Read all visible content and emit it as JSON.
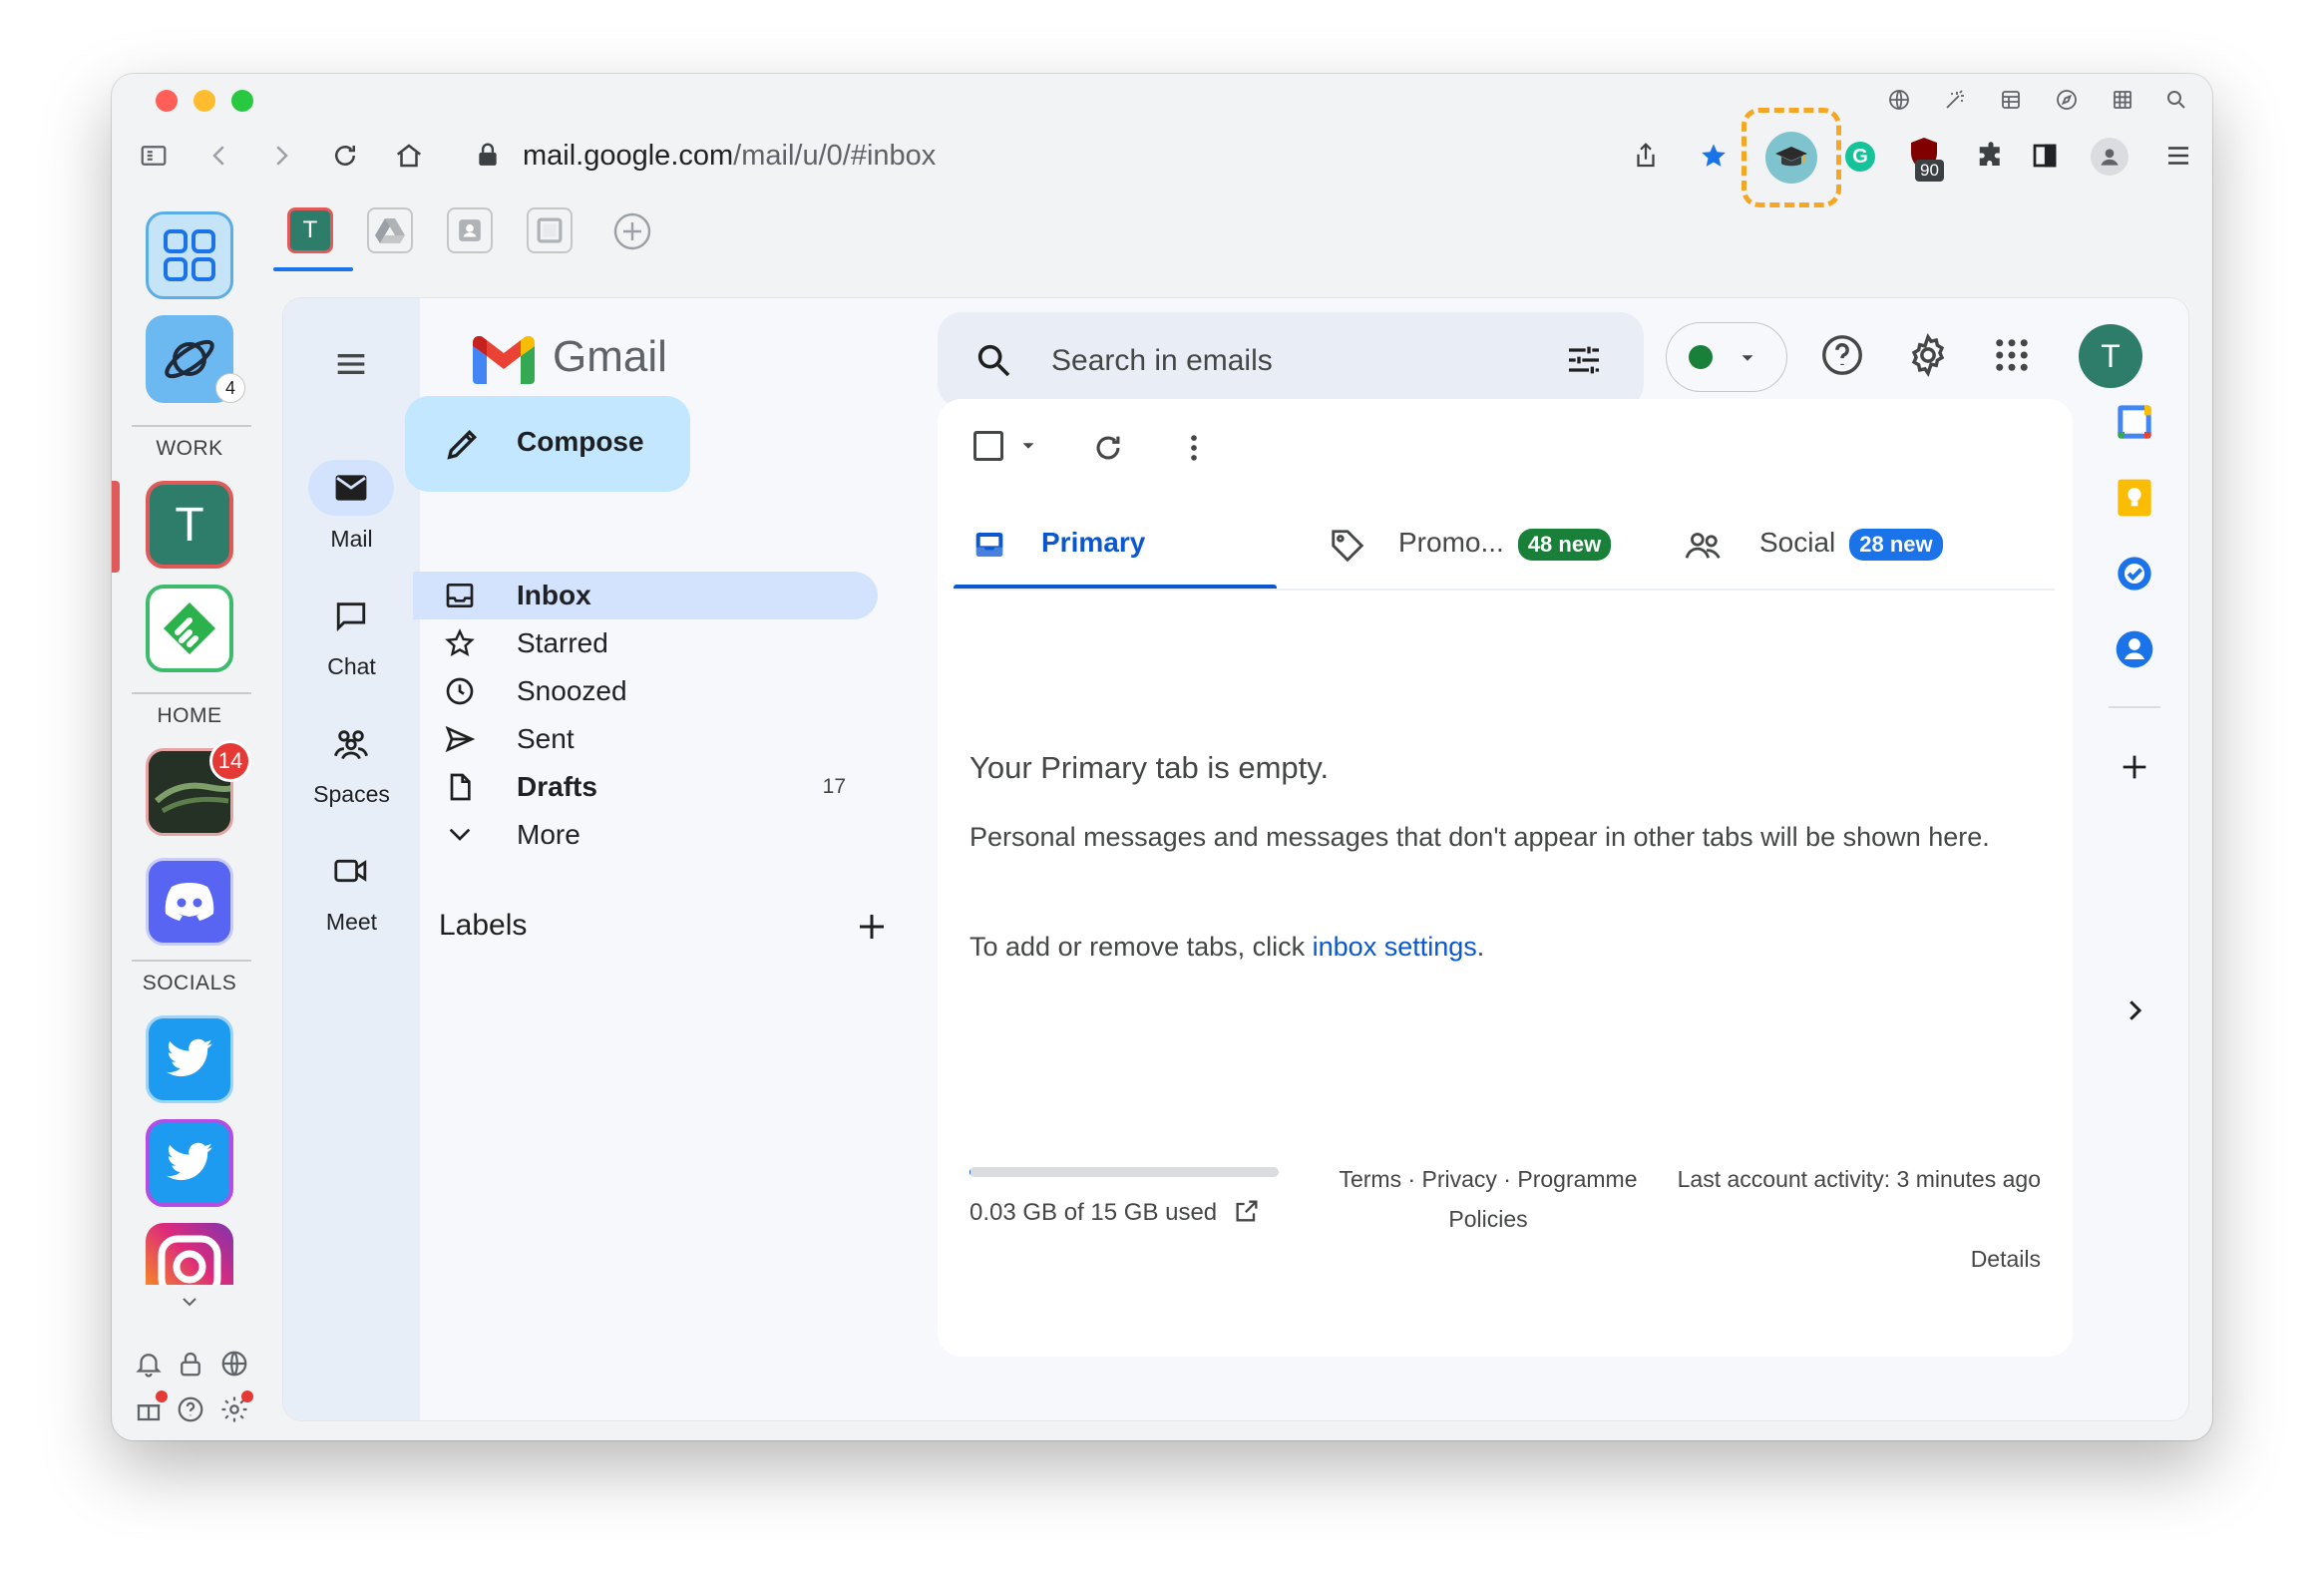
{
  "browser": {
    "url_host": "mail.google.com",
    "url_path": "/mail/u/0/#inbox",
    "pinned_tabs": [
      "T"
    ],
    "extension_badge": "90"
  },
  "sidebar": {
    "top_badge": "4",
    "sections": {
      "work": "WORK",
      "home": "HOME",
      "socials": "SOCIALS"
    },
    "work_app_letter": "T",
    "home_badge": "14"
  },
  "gmail": {
    "brand": "Gmail",
    "compose_label": "Compose",
    "search_placeholder": "Search in emails",
    "avatar_letter": "T",
    "rail": {
      "mail": "Mail",
      "chat": "Chat",
      "spaces": "Spaces",
      "meet": "Meet"
    },
    "nav": {
      "inbox": "Inbox",
      "starred": "Starred",
      "snoozed": "Snoozed",
      "sent": "Sent",
      "drafts": "Drafts",
      "drafts_count": "17",
      "more": "More"
    },
    "labels_heading": "Labels",
    "tabs": {
      "primary": "Primary",
      "promotions": "Promo...",
      "promotions_badge": "48 new",
      "social": "Social",
      "social_badge": "28 new"
    },
    "empty": {
      "title": "Your Primary tab is empty.",
      "body": "Personal messages and messages that don't appear in other tabs will be shown here.",
      "tabs_prefix": "To add or remove tabs, click ",
      "tabs_link": "inbox settings",
      "tabs_suffix": "."
    },
    "footer": {
      "storage": "0.03 GB of 15 GB used",
      "storage_fraction": 0.002,
      "terms": "Terms · Privacy · Programme Policies",
      "activity": "Last account activity: 3 minutes ago",
      "details": "Details"
    }
  },
  "colors": {
    "accent": "#0b57d0",
    "promo_badge": "#188038",
    "social_badge": "#1a73e8",
    "avatar": "#2e7d6b",
    "highlight": "#f5a623"
  }
}
